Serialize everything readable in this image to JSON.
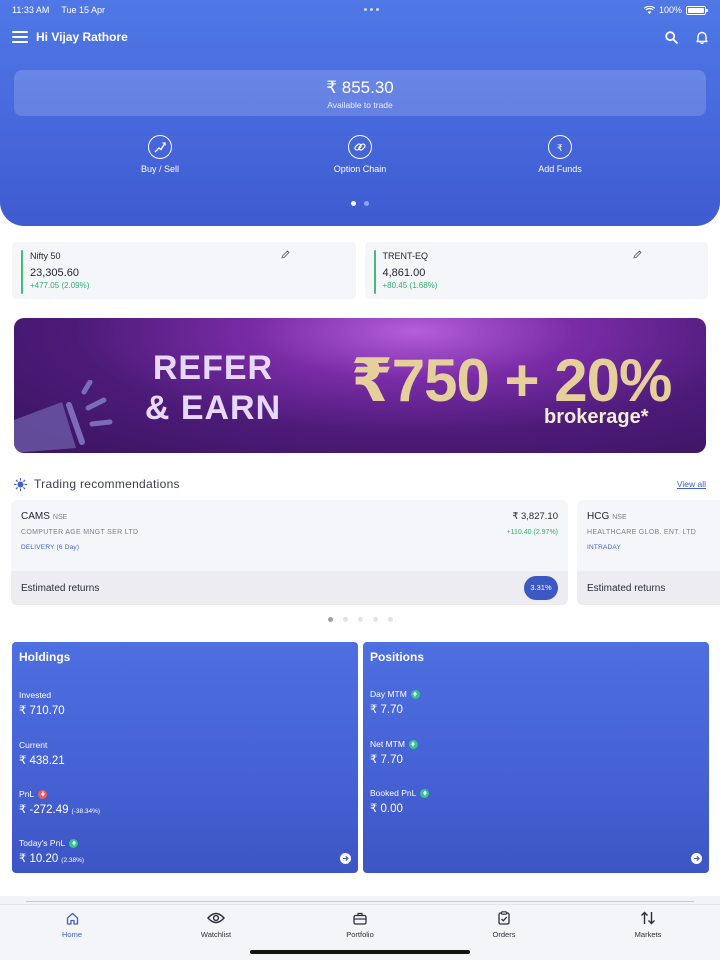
{
  "status_bar": {
    "time": "11:33 AM",
    "date": "Tue 15 Apr",
    "battery": "100%",
    "battery_level": 1.0
  },
  "header": {
    "greeting": "Hi Vijay Rathore"
  },
  "balance": {
    "amount": "₹ 855.30",
    "label": "Available to trade"
  },
  "quick_actions": [
    {
      "label": "Buy / Sell",
      "icon": "trend-line-icon"
    },
    {
      "label": "Option Chain",
      "icon": "link-icon"
    },
    {
      "label": "Add Funds",
      "icon": "rupee-plus-icon"
    }
  ],
  "hero_pager": {
    "pages": 2,
    "active": 0
  },
  "tickers": [
    {
      "name": "Nifty 50",
      "value": "23,305.60",
      "change": "+477.05 (2.09%)"
    },
    {
      "name": "TRENT-EQ",
      "value": "4,861.00",
      "change": "+80.45 (1.68%)"
    }
  ],
  "banner": {
    "headline": "REFER & EARN",
    "offer": "₹750 + 20%",
    "sub": "brokerage*"
  },
  "recommendations": {
    "title": "Trading recommendations",
    "view_all": "View all",
    "cards": [
      {
        "symbol": "CAMS",
        "exchange": "NSE",
        "company": "COMPUTER AGE MNGT SER LTD",
        "type": "DELIVERY (6 Day)",
        "price": "₹ 3,827.10",
        "change": "+110.40 (2.97%)",
        "est_label": "Estimated returns",
        "est_value": "3.31%"
      },
      {
        "symbol": "HCG",
        "exchange": "NSE",
        "company": "HEALTHCARE GLOB. ENT. LTD",
        "type": "INTRADAY",
        "est_label": "Estimated returns"
      }
    ],
    "pager": {
      "pages": 5,
      "active": 0
    }
  },
  "holdings": {
    "title": "Holdings",
    "invested_label": "Invested",
    "invested_value": "₹ 710.70",
    "current_label": "Current",
    "current_value": "₹ 438.21",
    "pnl_label": "PnL",
    "pnl_value": "₹ -272.49",
    "pnl_pct": "(-38.34%)",
    "today_label": "Today's PnL",
    "today_value": "₹ 10.20",
    "today_pct": "(2.38%)"
  },
  "positions": {
    "title": "Positions",
    "day_label": "Day MTM",
    "day_value": "₹ 7.70",
    "net_label": "Net MTM",
    "net_value": "₹ 7.70",
    "booked_label": "Booked PnL",
    "booked_value": "₹ 0.00"
  },
  "tabs": [
    {
      "label": "Home",
      "active": true
    },
    {
      "label": "Watchlist"
    },
    {
      "label": "Portfolio"
    },
    {
      "label": "Orders"
    },
    {
      "label": "Markets"
    }
  ],
  "colors": {
    "primary": "#4768dc",
    "positive": "#2fb06a",
    "negative": "#ef5d5d",
    "link": "#3e5fd0"
  }
}
